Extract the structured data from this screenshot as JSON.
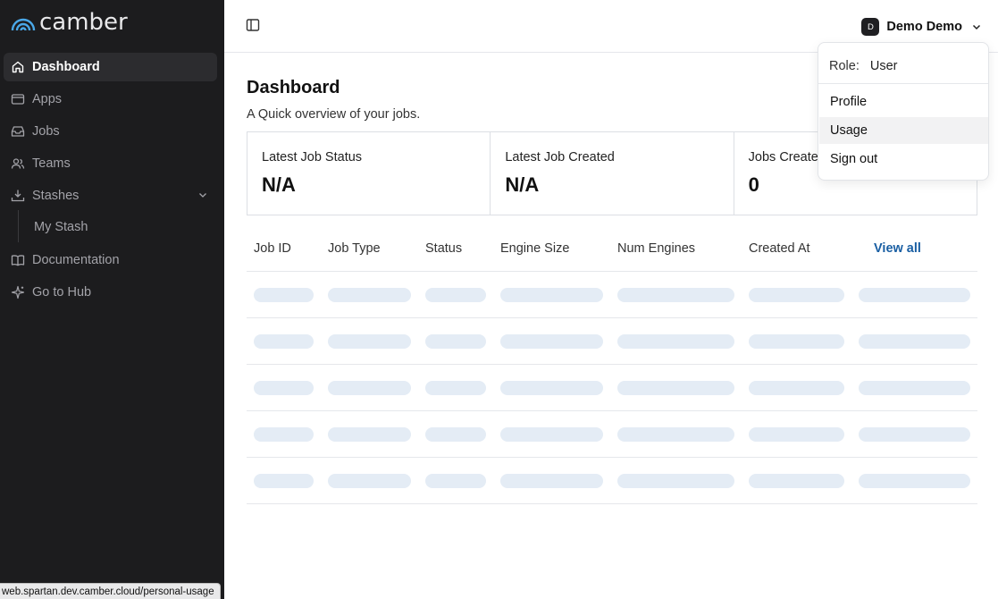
{
  "app": {
    "logo_text": "camber"
  },
  "sidebar": {
    "items": [
      {
        "label": "Dashboard",
        "icon": "home-icon",
        "active": true
      },
      {
        "label": "Apps",
        "icon": "window-icon"
      },
      {
        "label": "Jobs",
        "icon": "inbox-icon"
      },
      {
        "label": "Teams",
        "icon": "users-icon"
      },
      {
        "label": "Stashes",
        "icon": "download-tray-icon",
        "expanded": true
      },
      {
        "label": "My Stash",
        "sub": true
      },
      {
        "label": "Documentation",
        "icon": "book-icon"
      },
      {
        "label": "Go to Hub",
        "icon": "sparkle-icon"
      }
    ]
  },
  "status_bar": {
    "url": "web.spartan.dev.camber.cloud/personal-usage"
  },
  "header": {
    "user_initial": "D",
    "user_name": "Demo Demo"
  },
  "dashboard": {
    "title": "Dashboard",
    "subtitle": "A Quick overview of your jobs.",
    "cards": [
      {
        "label": "Latest Job Status",
        "value": "N/A"
      },
      {
        "label": "Latest Job Created",
        "value": "N/A"
      },
      {
        "label": "Jobs Created",
        "value": "0"
      }
    ],
    "table": {
      "columns": [
        "Job ID",
        "Job Type",
        "Status",
        "Engine Size",
        "Num Engines",
        "Created At"
      ],
      "view_all": "View all"
    }
  },
  "dropdown": {
    "role_label": "Role:",
    "role_value": "User",
    "items": [
      "Profile",
      "Usage",
      "Sign out"
    ]
  },
  "colors": {
    "sidebar_bg": "#1c1c1e",
    "link": "#1a5fa3",
    "skeleton": "#e4ecf5"
  }
}
